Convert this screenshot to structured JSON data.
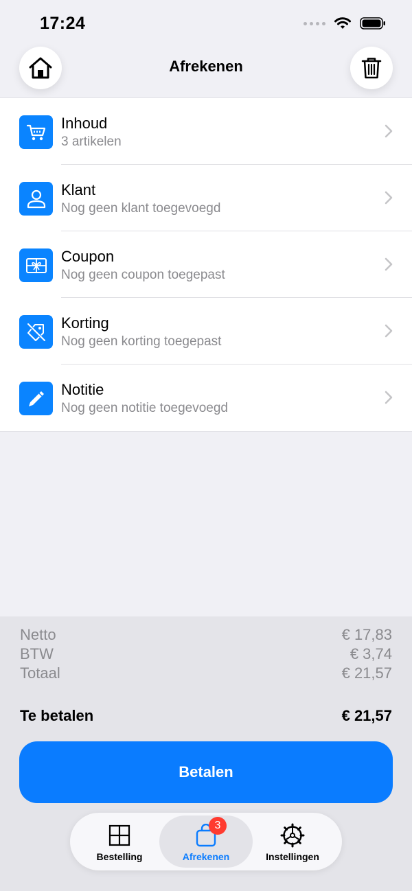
{
  "status_bar": {
    "time": "17:24"
  },
  "header": {
    "title": "Afrekenen"
  },
  "rows": [
    {
      "icon": "cart-icon",
      "title": "Inhoud",
      "subtitle": "3 artikelen"
    },
    {
      "icon": "person-icon",
      "title": "Klant",
      "subtitle": "Nog geen klant toegevoegd"
    },
    {
      "icon": "gift-card-icon",
      "title": "Coupon",
      "subtitle": "Nog geen coupon toegepast"
    },
    {
      "icon": "tag-slash-icon",
      "title": "Korting",
      "subtitle": "Nog geen korting toegepast"
    },
    {
      "icon": "pencil-icon",
      "title": "Notitie",
      "subtitle": "Nog geen notitie toegevoegd"
    }
  ],
  "summary": {
    "netto_label": "Netto",
    "netto_value": "€ 17,83",
    "btw_label": "BTW",
    "btw_value": "€ 3,74",
    "totaal_label": "Totaal",
    "totaal_value": "€ 21,57",
    "pay_label": "Te betalen",
    "pay_value": "€ 21,57"
  },
  "pay_button": {
    "label": "Betalen"
  },
  "tabbar": {
    "tabs": [
      {
        "label": "Bestelling",
        "icon": "grid-icon"
      },
      {
        "label": "Afrekenen",
        "icon": "bag-icon",
        "badge": "3"
      },
      {
        "label": "Instellingen",
        "icon": "gear-icon"
      }
    ]
  },
  "colors": {
    "accent": "#0a7cff",
    "badge": "#ff3b30",
    "secondary_text": "#8a8a8e"
  }
}
